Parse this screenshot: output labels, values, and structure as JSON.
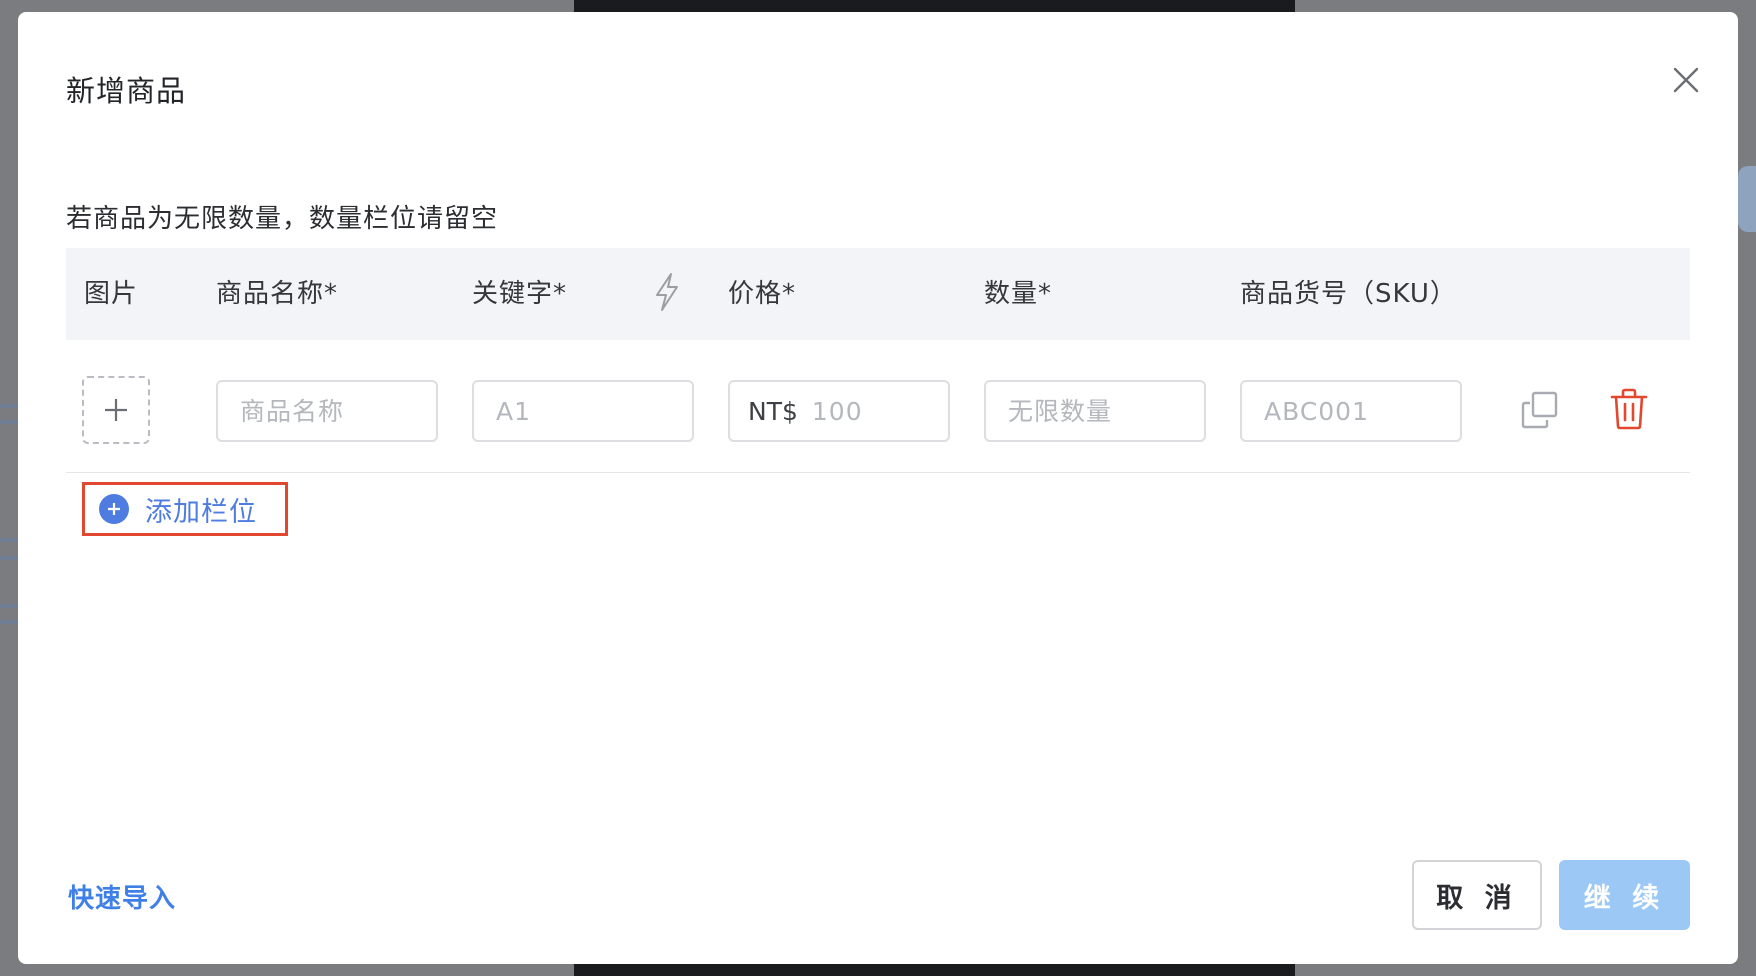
{
  "modal": {
    "title": "新增商品",
    "hint": "若商品为无限数量，数量栏位请留空"
  },
  "table": {
    "columns": [
      "图片",
      "商品名称*",
      "关键字*",
      "价格*",
      "数量*",
      "商品货号（SKU）"
    ],
    "row": {
      "name_placeholder": "商品名称",
      "keyword_placeholder": "A1",
      "price_prefix": "NT$",
      "price_placeholder": "100",
      "quantity_placeholder": "无限数量",
      "sku_placeholder": "ABC001"
    }
  },
  "add_row": {
    "label": "添加栏位"
  },
  "footer": {
    "quick_import": "快速导入",
    "cancel": "取 消",
    "continue": "继 续"
  },
  "icons": {
    "close": "close-icon",
    "bolt": "lightning-icon",
    "upload": "plus-icon",
    "copy": "copy-icon",
    "delete": "trash-icon",
    "add": "plus-circle-icon"
  },
  "colors": {
    "accent": "#4e7ce0",
    "link": "#3f80e6",
    "danger": "#e2482f",
    "primary_disabled": "#9cc8f6",
    "header_bg": "#f3f4f8"
  }
}
